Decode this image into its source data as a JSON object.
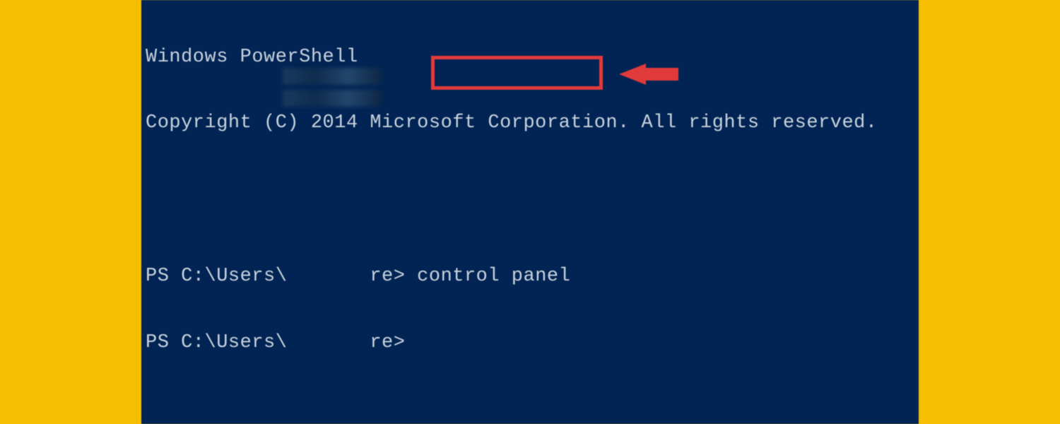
{
  "header": {
    "title": "Windows PowerShell",
    "copyright": "Copyright (C) 2014 Microsoft Corporation. All rights reserved."
  },
  "prompt": {
    "prefix": "PS C:\\Users\\",
    "redacted_suffix": "re>",
    "command": "control panel"
  },
  "colors": {
    "bg": "#012454",
    "fg": "#c8d2dc",
    "highlight": "#e03a3a",
    "page_bg": "#f6be00"
  }
}
